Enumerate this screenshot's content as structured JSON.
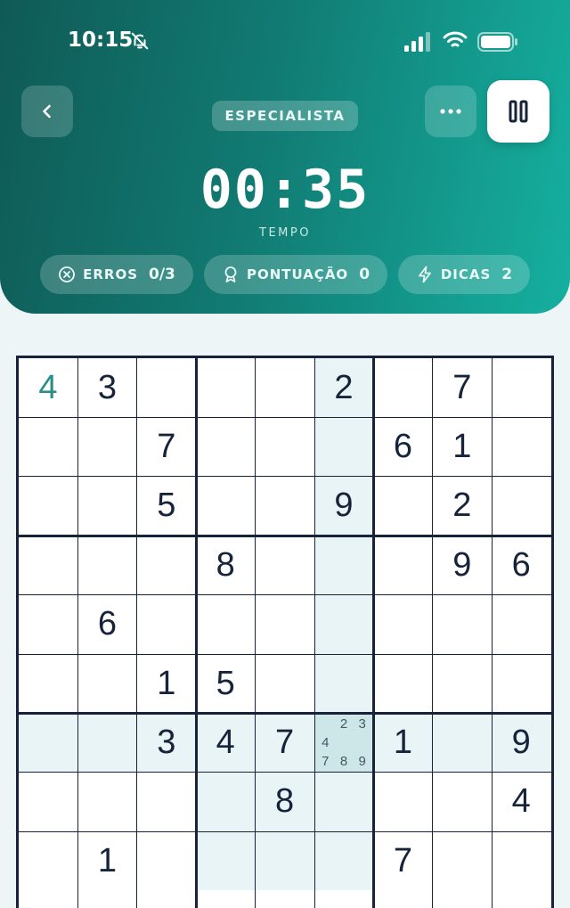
{
  "status_bar": {
    "time": "10:15",
    "icons": [
      "bell-slash-icon",
      "signal-icon",
      "wifi-icon",
      "battery-icon"
    ]
  },
  "header": {
    "difficulty": "ESPECIALISTA",
    "timer": "00:35",
    "timer_label": "TEMPO",
    "back_icon": "chevron-left-icon",
    "more_icon": "ellipsis-icon",
    "pause_icon": "pause-icon",
    "stats": {
      "errors": {
        "label": "ERROS",
        "value": "0/3",
        "icon": "x-circle-icon"
      },
      "score": {
        "label": "PONTUAÇÃO",
        "value": "0",
        "icon": "award-icon"
      },
      "hints": {
        "label": "DICAS",
        "value": "2",
        "icon": "lightning-icon"
      }
    }
  },
  "colors": {
    "header_start": "#0f5a56",
    "header_end": "#15b0a0",
    "grid_line": "#16233a",
    "digit": "#16233a",
    "user_digit": "#2a8f8a",
    "highlight": "#e8f4f5",
    "selected": "#cde7e8"
  },
  "board": {
    "selected": [
      6,
      5
    ],
    "rows": [
      [
        "4",
        "3",
        "",
        "",
        "",
        "2",
        "",
        "7",
        ""
      ],
      [
        "",
        "",
        "7",
        "",
        "",
        "",
        "6",
        "1",
        ""
      ],
      [
        "",
        "",
        "5",
        "",
        "",
        "9",
        "",
        "2",
        ""
      ],
      [
        "",
        "",
        "",
        "8",
        "",
        "",
        "",
        "9",
        "6"
      ],
      [
        "",
        "6",
        "",
        "",
        "",
        "",
        "",
        "",
        ""
      ],
      [
        "",
        "",
        "1",
        "5",
        "",
        "",
        "",
        "",
        ""
      ],
      [
        "",
        "",
        "3",
        "4",
        "7",
        "",
        "1",
        "",
        "9"
      ],
      [
        "",
        "",
        "",
        "",
        "8",
        "",
        "",
        "",
        "4"
      ],
      [
        "",
        "1",
        "",
        "",
        "",
        "",
        "7",
        "",
        ""
      ]
    ],
    "user_cells": [
      [
        0,
        0
      ]
    ],
    "notes": [
      {
        "row": 6,
        "col": 5,
        "values": [
          "",
          "2",
          "3",
          "4",
          "",
          "",
          "7",
          "8",
          "9"
        ]
      }
    ]
  }
}
